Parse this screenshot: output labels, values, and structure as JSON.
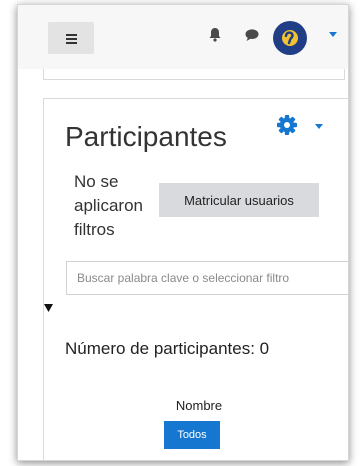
{
  "navbar": {
    "menu_icon": "hamburger-icon",
    "notifications_icon": "bell-icon",
    "messages_icon": "chat-bubble-icon",
    "avatar_icon": "user-avatar",
    "avatar_color": "#1f3e86",
    "user_menu_icon": "chevron-down-icon"
  },
  "participants": {
    "title": "Participantes",
    "settings_icon": "gear-icon",
    "settings_menu_icon": "chevron-down-icon",
    "accent_color": "#1577cf",
    "no_filters_text": "No se aplicaron filtros",
    "enrol_button": "Matricular usuarios",
    "search_placeholder": "Buscar palabra clave o seleccionar filtro",
    "collapse_icon": "triangle-down-icon",
    "count_text": "Número de participantes: 0",
    "initials_filter_label": "Nombre",
    "all_button": "Todos"
  }
}
